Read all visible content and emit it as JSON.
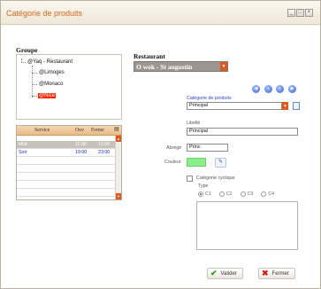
{
  "window": {
    "title": "Catégorie de produits",
    "buttons": {
      "minimize": "_",
      "maximize": "□",
      "close": "×"
    }
  },
  "groupe": {
    "label": "Groupe",
    "tree": {
      "root": "@Yaq - Restaurant",
      "children": [
        "@Limoges",
        "@Monaco",
        "@Nice"
      ],
      "selected": "@Nice"
    }
  },
  "restaurant": {
    "label": "Restaurant",
    "selected": "O wok - St augustin"
  },
  "categorie": {
    "label": "Catégorie de produits",
    "selected": "Principal",
    "nav_icons": [
      "first-icon",
      "previous-icon",
      "next-icon",
      "last-icon"
    ]
  },
  "libelle": {
    "label": "Libellé",
    "value": "Principal"
  },
  "abrege": {
    "label": "Abrégé",
    "value": "Princ"
  },
  "couleur": {
    "label": "Couleur",
    "value": "#88f088"
  },
  "cyclique": {
    "label": "Catégorie cyclique",
    "checked": false
  },
  "type": {
    "label": "Type",
    "options": [
      "C1",
      "C2",
      "C3",
      "C4"
    ],
    "selected": "C1"
  },
  "services_table": {
    "columns": [
      "Service",
      "Ouv",
      "Ferme"
    ],
    "rows": [
      {
        "service": "Midi",
        "ouverture": "11:00",
        "fermeture": "15:00"
      },
      {
        "service": "Soir",
        "ouverture": "19:00",
        "fermeture": "23:00"
      }
    ]
  },
  "actions": {
    "validate": "Valider",
    "close": "Fermer"
  },
  "colors": {
    "accent": "#e1581b",
    "title": "#d5651e",
    "nav": "#3c5fc8"
  }
}
